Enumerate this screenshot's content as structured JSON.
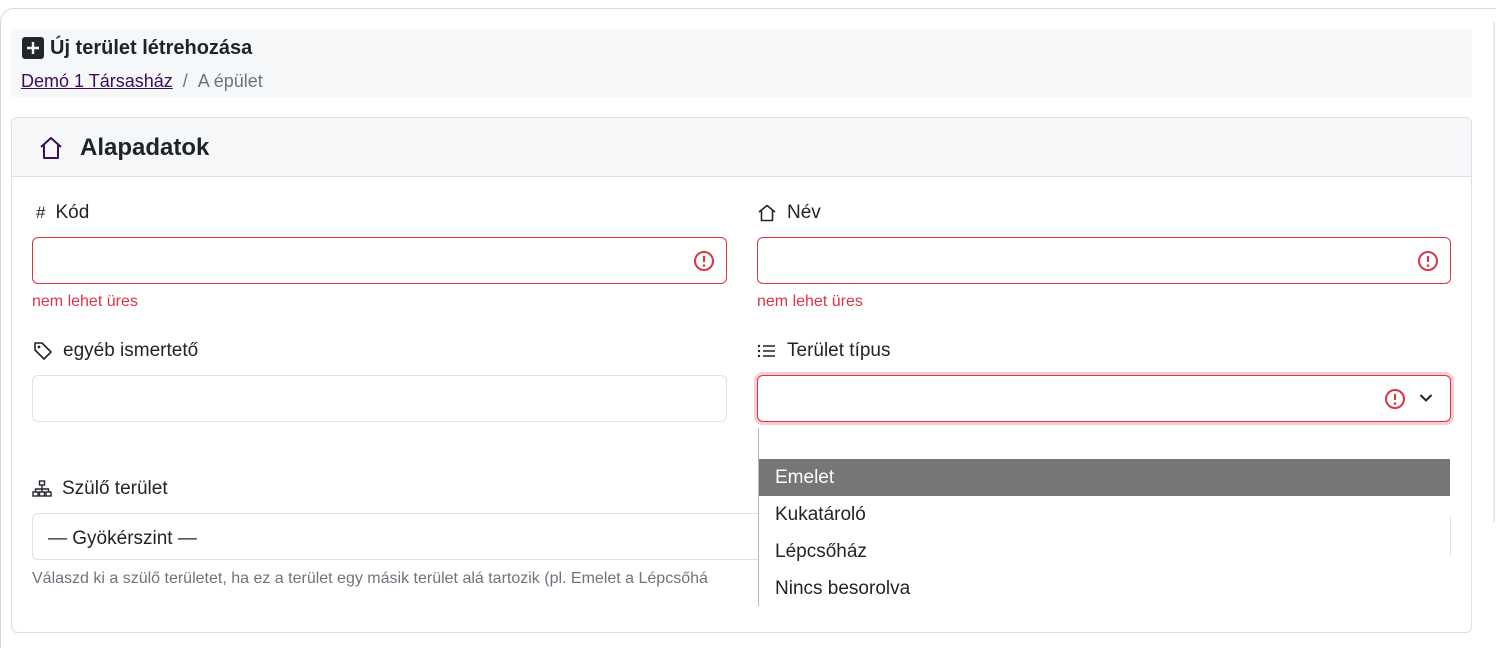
{
  "page": {
    "title": "Új terület létrehozása",
    "breadcrumb": {
      "link": "Demó 1 Társasház",
      "separator": "/",
      "current": "A épület"
    }
  },
  "card": {
    "title": "Alapadatok",
    "fields": {
      "kod": {
        "label": "Kód",
        "value": "",
        "error": "nem lehet üres",
        "icon": "hash-icon"
      },
      "nev": {
        "label": "Név",
        "value": "",
        "error": "nem lehet üres",
        "icon": "house-icon"
      },
      "ismerteto": {
        "label": "egyéb ismertető",
        "value": "",
        "icon": "tag-icon"
      },
      "tipus": {
        "label": "Terület típus",
        "value": "",
        "icon": "list-icon",
        "options": [
          "",
          "Emelet",
          "Kukatároló",
          "Lépcsőház",
          "Nincs besorolva"
        ],
        "highlighted": "Emelet"
      },
      "szulo": {
        "label": "Szülő terület",
        "value": "— Gyökérszint —",
        "icon": "sitemap-icon",
        "help": "Válaszd ki a szülő területet, ha ez a terület egy másik terület alá tartozik (pl. Emelet a Lépcsőhá"
      }
    }
  },
  "colors": {
    "error": "#dc3545",
    "highlight": "#767676",
    "link": "#3b0d5b"
  }
}
